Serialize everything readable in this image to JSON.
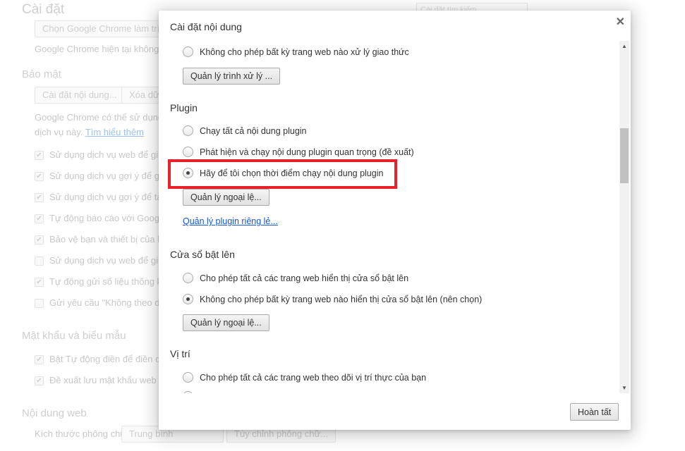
{
  "background": {
    "title": "Cài đặt",
    "search_placeholder": "Cài đặt tìm kiếm",
    "default_browser_button": "Chọn Google Chrome làm trình",
    "default_browser_text": "Google Chrome hiện tại không ph",
    "privacy_heading": "Bảo mật",
    "content_settings_button": "Cài đặt nội dung...",
    "clear_data_button": "Xóa dữ",
    "privacy_text_1": "Google Chrome có thể sử dụng d",
    "privacy_text_2": "dịch vụ này.",
    "learn_more": "Tìm hiểu thêm",
    "checkboxes": [
      {
        "label": "Sử dụng dịch vụ web để giúp",
        "checked": true
      },
      {
        "label": "Sử dụng dịch vụ gợi ý để giúp",
        "checked": true
      },
      {
        "label": "Sử dụng dịch vụ gợi ý để tải t",
        "checked": true
      },
      {
        "label": "Tự động báo cáo với Google",
        "checked": true
      },
      {
        "label": "Bảo vệ bạn và thiết bị của bạn",
        "checked": true
      },
      {
        "label": "Sử dụng dịch vụ web để giúp",
        "checked": false
      },
      {
        "label": "Tự động gửi số liệu thống kê",
        "checked": true
      },
      {
        "label": "Gửi yêu cầu \"Không theo dõi\"",
        "checked": false
      }
    ],
    "passwords_heading": "Mật khẩu và biểu mẫu",
    "password_checkboxes": [
      {
        "label": "Bật Tự động điền để điền các",
        "checked": true
      },
      {
        "label": "Đề xuất lưu mật khẩu web củ",
        "checked": true
      }
    ],
    "web_content_heading": "Nội dung web",
    "font_size_label": "Kích thước phông chữ:",
    "font_size_value": "Trung bình",
    "customize_fonts_button": "Tùy chỉnh phông chữ..."
  },
  "dialog": {
    "title": "Cài đặt nội dung",
    "handlers_block_option": "Không cho phép bất kỳ trang web nào xử lý giao thức",
    "manage_handlers_button": "Quản lý trình xử lý ...",
    "plugin_heading": "Plugin",
    "plugin_options": [
      {
        "label": "Chạy tất cả nội dung plugin",
        "selected": false
      },
      {
        "label": "Phát hiện và chạy nội dung plugin quan trọng (đề xuất)",
        "selected": false
      },
      {
        "label": "Hãy để tôi chọn thời điểm chạy nội dung plugin",
        "selected": true
      }
    ],
    "plugin_exceptions_button": "Quản lý ngoại lệ...",
    "manage_plugins_link": "Quản lý plugin riêng lẻ...",
    "popup_heading": "Cửa sổ bật lên",
    "popup_options": [
      {
        "label": "Cho phép tất cả các trang web hiển thị cửa sổ bật lên",
        "selected": false
      },
      {
        "label": "Không cho phép bất kỳ trang web nào hiển thị cửa sổ bật lên (nên chọn)",
        "selected": true
      }
    ],
    "popup_exceptions_button": "Quản lý ngoại lệ...",
    "location_heading": "Vị trí",
    "location_option": "Cho phép tất cả các trang web theo dõi vị trí thực của bạn",
    "done_button": "Hoàn tất",
    "close_icon": "close-icon",
    "highlight_color": "#e8202a"
  }
}
